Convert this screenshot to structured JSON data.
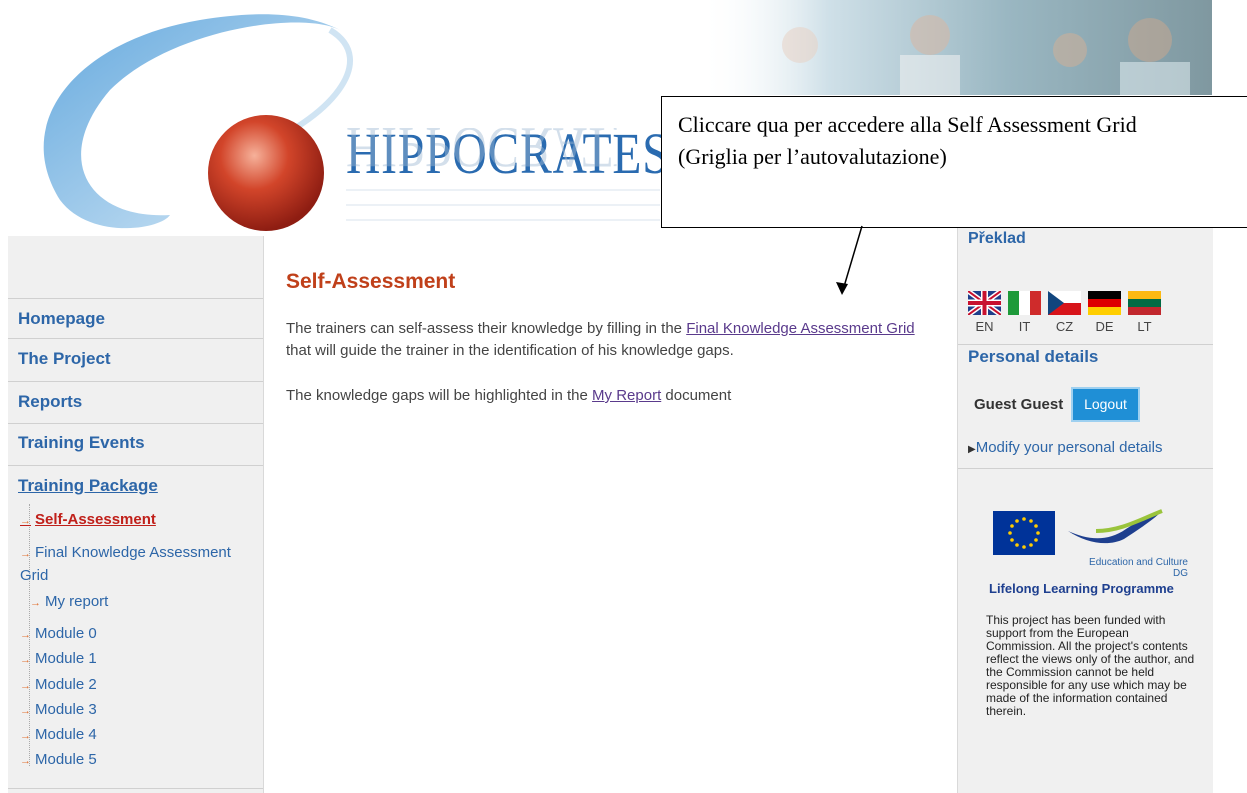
{
  "header": {
    "logo_text": "HIPPOCRATES"
  },
  "left_nav": {
    "items": [
      {
        "label": "Homepage"
      },
      {
        "label": "The Project"
      },
      {
        "label": "Reports"
      },
      {
        "label": "Training Events"
      },
      {
        "label": "Training Package"
      }
    ],
    "sub_items": [
      {
        "label": "Self-Assessment",
        "active": true
      },
      {
        "label": "Final Knowledge Assessment Grid"
      },
      {
        "label": "My report"
      },
      {
        "label": "Module 0"
      },
      {
        "label": "Module 1"
      },
      {
        "label": "Module 2"
      },
      {
        "label": "Module 3"
      },
      {
        "label": "Module 4"
      },
      {
        "label": "Module 5"
      }
    ]
  },
  "main": {
    "title": "Self-Assessment",
    "para1_before": "The trainers can self-assess their knowledge by filling in the ",
    "para1_link": "Final Knowledge Assessment Grid",
    "para1_after": " that will guide the trainer in the identification of his knowledge gaps.",
    "para2_before": "The knowledge gaps will be highlighted in the ",
    "para2_link": "My Report",
    "para2_after": " document"
  },
  "right_sidebar": {
    "translate_heading": "Překlad",
    "languages": [
      "EN",
      "IT",
      "CZ",
      "DE",
      "LT"
    ],
    "personal_heading": "Personal details",
    "user_name": "Guest Guest",
    "logout_label": "Logout",
    "modify_link": "Modify your personal details",
    "eu_dg_label": "Education and Culture DG",
    "llp_label": "Lifelong Learning Programme",
    "eu_disclaimer": "This project has been funded with support from the European Commission. All the project's contents reflect the views only of the author, and the Commission cannot be held responsible for any use which may be made of the information contained therein."
  },
  "callout": {
    "text": "Cliccare qua per accedere alla Self Assessment Grid (Griglia per l’autovalutazione)"
  },
  "colors": {
    "nav_blue": "#2d66a8",
    "title_red": "#c0401a",
    "link_purple": "#5a3a8c",
    "logout_bg": "#1f8fd6"
  }
}
